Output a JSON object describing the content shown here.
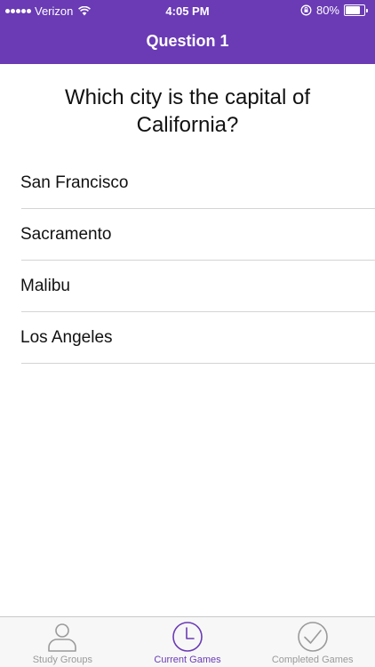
{
  "status_bar": {
    "carrier": "Verizon",
    "time": "4:05 PM",
    "battery_percent": "80%",
    "battery_level": 0.8,
    "signal_bars": 5,
    "icons": [
      "signal-icon",
      "wifi-icon",
      "orientation-lock-icon",
      "battery-icon"
    ]
  },
  "nav": {
    "title": "Question 1"
  },
  "question": {
    "text": "Which city is the capital of California?"
  },
  "answers": [
    {
      "label": "San Francisco"
    },
    {
      "label": "Sacramento"
    },
    {
      "label": "Malibu"
    },
    {
      "label": "Los Angeles"
    }
  ],
  "tab_bar": {
    "tabs": [
      {
        "label": "Study Groups",
        "icon": "person-icon",
        "active": false
      },
      {
        "label": "Current Games",
        "icon": "clock-icon",
        "active": true
      },
      {
        "label": "Completed Games",
        "icon": "checkmark-circle-icon",
        "active": false
      }
    ]
  },
  "colors": {
    "accent": "#6a3bb5",
    "inactive_tab": "#9a9a9a",
    "separator": "#d4d4d4",
    "tab_bar_bg": "#f7f7f7"
  }
}
